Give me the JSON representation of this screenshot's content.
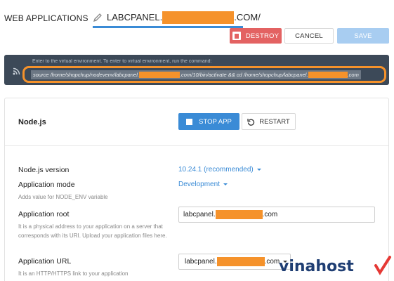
{
  "header": {
    "title": "WEB APPLICATIONS",
    "domain_prefix": "LABCPANEL.",
    "domain_suffix": ".COM/"
  },
  "toolbar": {
    "destroy_label": "DESTROY",
    "cancel_label": "CANCEL",
    "save_label": "SAVE"
  },
  "banner": {
    "text": "Enter to the virtual environment. To enter to virtual environment, run the command:",
    "command_part1": "source /home/shopchup/nodevenv/labcpanel.",
    "command_part2": ".com/10/bin/activate && cd /home/shopchup/labcpanel.",
    "command_part3": ".com"
  },
  "app": {
    "section_title": "Node.js",
    "stop_label": "STOP APP",
    "restart_label": "RESTART",
    "node_version_label": "Node.js version",
    "node_version_value": "10.24.1 (recommended)",
    "mode_label": "Application mode",
    "mode_hint": "Adds value for NODE_ENV variable",
    "mode_value": "Development",
    "root_label": "Application root",
    "root_hint": "It is a physical address to your application on a server that corresponds with its URI. Upload your application files here.",
    "root_prefix": "labcpanel.",
    "root_suffix": ".com",
    "url_label": "Application URL",
    "url_hint": "It is an HTTP/HTTPS link to your application",
    "url_prefix": "labcpanel.",
    "url_suffix": ".com"
  },
  "watermark": {
    "text": "vinahost"
  },
  "colors": {
    "accent": "#3a8bd6",
    "danger": "#e36262",
    "highlight": "#f5922b",
    "banner_bg": "#3c4958",
    "watermark": "#1f3e73"
  }
}
